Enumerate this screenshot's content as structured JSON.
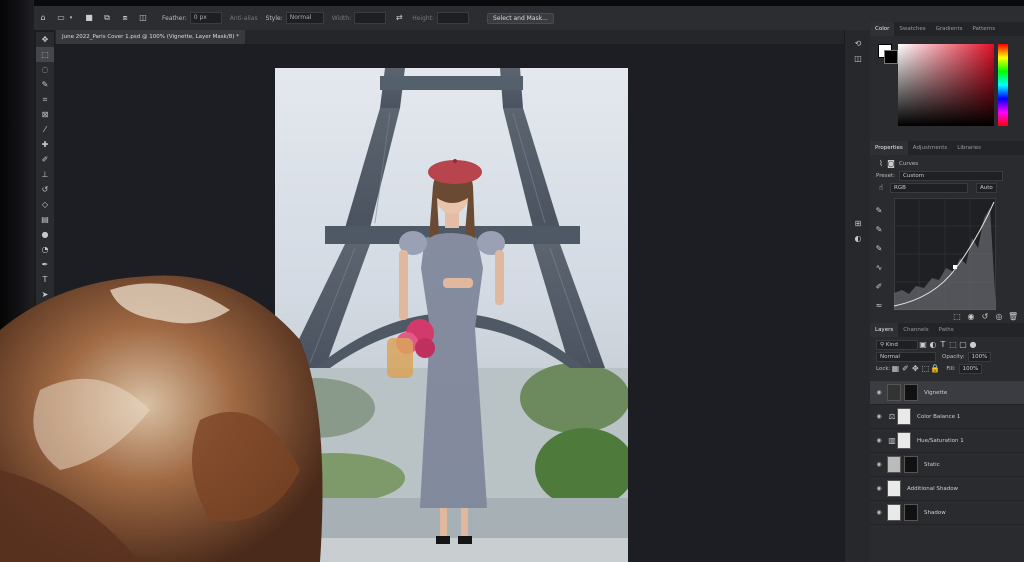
{
  "options_bar": {
    "feather_label": "Feather:",
    "feather_value": "0 px",
    "antialias_label": "Anti-alias",
    "style_label": "Style:",
    "style_value": "Normal",
    "width_label": "Width:",
    "height_label": "Height:",
    "select_mask_label": "Select and Mask..."
  },
  "document_tab": {
    "title": "June 2022_Paris Cover 1.psd @ 100% (Vignette, Layer Mask/8) *"
  },
  "color_panel": {
    "tabs": [
      "Color",
      "Swatches",
      "Gradients",
      "Patterns"
    ]
  },
  "properties_panel": {
    "tabs": [
      "Properties",
      "Adjustments",
      "Libraries"
    ],
    "adjustment_name": "Curves",
    "preset_label": "Preset:",
    "preset_value": "Custom",
    "channel_value": "RGB",
    "auto_label": "Auto"
  },
  "layers_panel": {
    "tabs": [
      "Layers",
      "Channels",
      "Paths"
    ],
    "filter_value": "Kind",
    "blend_mode": "Normal",
    "opacity_label": "Opacity:",
    "opacity_value": "100%",
    "lock_label": "Lock:",
    "fill_label": "Fill:",
    "fill_value": "100%",
    "layers": [
      {
        "name": "Vignette",
        "selected": true
      },
      {
        "name": "Color Balance 1",
        "selected": false
      },
      {
        "name": "Hue/Saturation 1",
        "selected": false
      },
      {
        "name": "Static",
        "selected": false
      },
      {
        "name": "Additional Shadow",
        "selected": false
      },
      {
        "name": "Shadow",
        "selected": false
      }
    ]
  },
  "colors": {
    "accent_hue_top": "#ff0000",
    "panel_bg": "#2a2b2e",
    "canvas_bg": "#1d1e23"
  }
}
